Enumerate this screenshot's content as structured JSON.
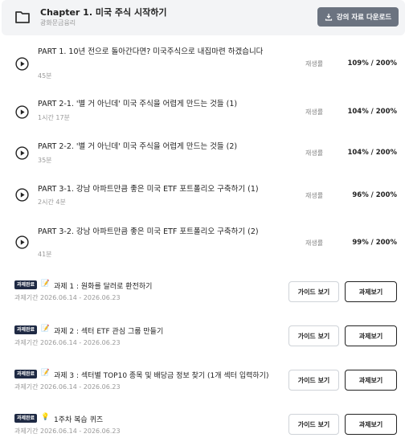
{
  "chapter": {
    "title": "Chapter 1. 미국 주식 시작하기",
    "subtitle": "광화문금융리",
    "download_label": "강의 자료 다운로드"
  },
  "lessons": [
    {
      "title": "PART 1. 10년 전으로 돌아간다면? 미국주식으로 내집마련 하겠습니다",
      "duration": "45분",
      "label": "재생률",
      "progress": "109% / 200%"
    },
    {
      "title": "PART 2-1. '별 거 아닌데' 미국 주식을 어렵게 만드는 것들 (1)",
      "duration": "1시간 17분",
      "label": "재생률",
      "progress": "104% / 200%"
    },
    {
      "title": "PART 2-2. '별 거 아닌데' 미국 주식을 어렵게 만드는 것들 (2)",
      "duration": "35분",
      "label": "재생률",
      "progress": "104% / 200%"
    },
    {
      "title": "PART 3-1. 강남 아파트만큼 좋은 미국 ETF 포트폴리오 구축하기 (1)",
      "duration": "2시간 4분",
      "label": "재생률",
      "progress": "96% / 200%"
    },
    {
      "title": "PART 3-2. 강남 아파트만큼 좋은 미국 ETF 포트폴리오 구축하기 (2)",
      "duration": "41분",
      "label": "재생률",
      "progress": "99% / 200%"
    }
  ],
  "tasks": [
    {
      "badge": "과제완료",
      "emoji": "📝",
      "title": "과제 1 : 원화를 달러로 환전하기",
      "period": "과제기간 2026.06.14 - 2026.06.23",
      "guide_label": "가이드 보기",
      "task_label": "과제보기"
    },
    {
      "badge": "과제완료",
      "emoji": "📝",
      "title": "과제 2 : 섹터 ETF 관심 그룹 만들기",
      "period": "과제기간 2026.06.14 - 2026.06.23",
      "guide_label": "가이드 보기",
      "task_label": "과제보기"
    },
    {
      "badge": "과제완료",
      "emoji": "📝",
      "title": "과제 3 : 섹터별 TOP10 종목 및 배당금 정보 찾기 (1개 섹터 입력하기)",
      "period": "과제기간 2026.06.14 - 2026.06.23",
      "guide_label": "가이드 보기",
      "task_label": "과제보기"
    },
    {
      "badge": "과제완료",
      "emoji": "💡",
      "title": "1주차 복습 퀴즈",
      "period": "과제기간 2026.06.14 - 2026.06.23",
      "guide_label": "가이드 보기",
      "task_label": "과제보기"
    }
  ]
}
